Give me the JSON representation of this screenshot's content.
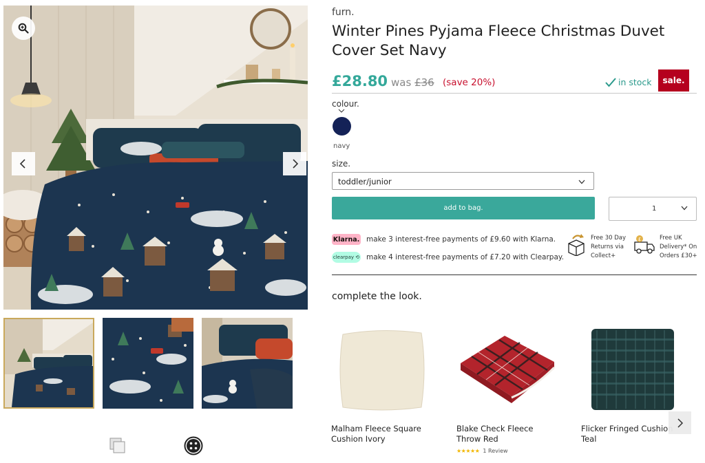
{
  "gallery": {
    "zoom_icon": "zoom-in-icon",
    "prev_icon": "chevron-left-icon",
    "next_icon": "chevron-right-icon",
    "tool_icons": [
      "image-stack-icon",
      "more-dots-icon"
    ]
  },
  "product": {
    "brand": "furn.",
    "title": "Winter Pines Pyjama Fleece Christmas Duvet Cover Set Navy",
    "price_now": "£28.80",
    "price_was_prefix": "was",
    "price_was": "£36",
    "price_save": "(save 20%)",
    "stock": "in stock",
    "sale_badge": "sale."
  },
  "colour": {
    "label": "colour.",
    "swatch_color": "#142257",
    "selected_name": "navy"
  },
  "size": {
    "label": "size.",
    "selected": "toddler/junior"
  },
  "actions": {
    "add_to_bag": "add to bag.",
    "quantity": "1"
  },
  "payments": {
    "klarna_badge": "Klarna.",
    "klarna_text": "make 3 interest-free payments of £9.60 with Klarna.",
    "clearpay_badge": "clearpay",
    "clearpay_text": "make 4 interest-free payments of £7.20 with Clearpay."
  },
  "usps": {
    "returns": "Free 30 Day Returns via Collect+",
    "delivery": "Free UK Delivery* On Orders £30+"
  },
  "complete_the_look": {
    "heading": "complete the look.",
    "items": [
      {
        "name": "Malham Fleece Square Cushion Ivory"
      },
      {
        "name": "Blake Check Fleece Throw Red",
        "stars": "★★★★★",
        "reviews": "1 Review"
      },
      {
        "name": "Flicker Fringed Cushion Teal"
      }
    ]
  },
  "colors": {
    "accent_teal": "#3aa89b",
    "sale_red": "#b5001e",
    "save_red": "#c8102e"
  }
}
